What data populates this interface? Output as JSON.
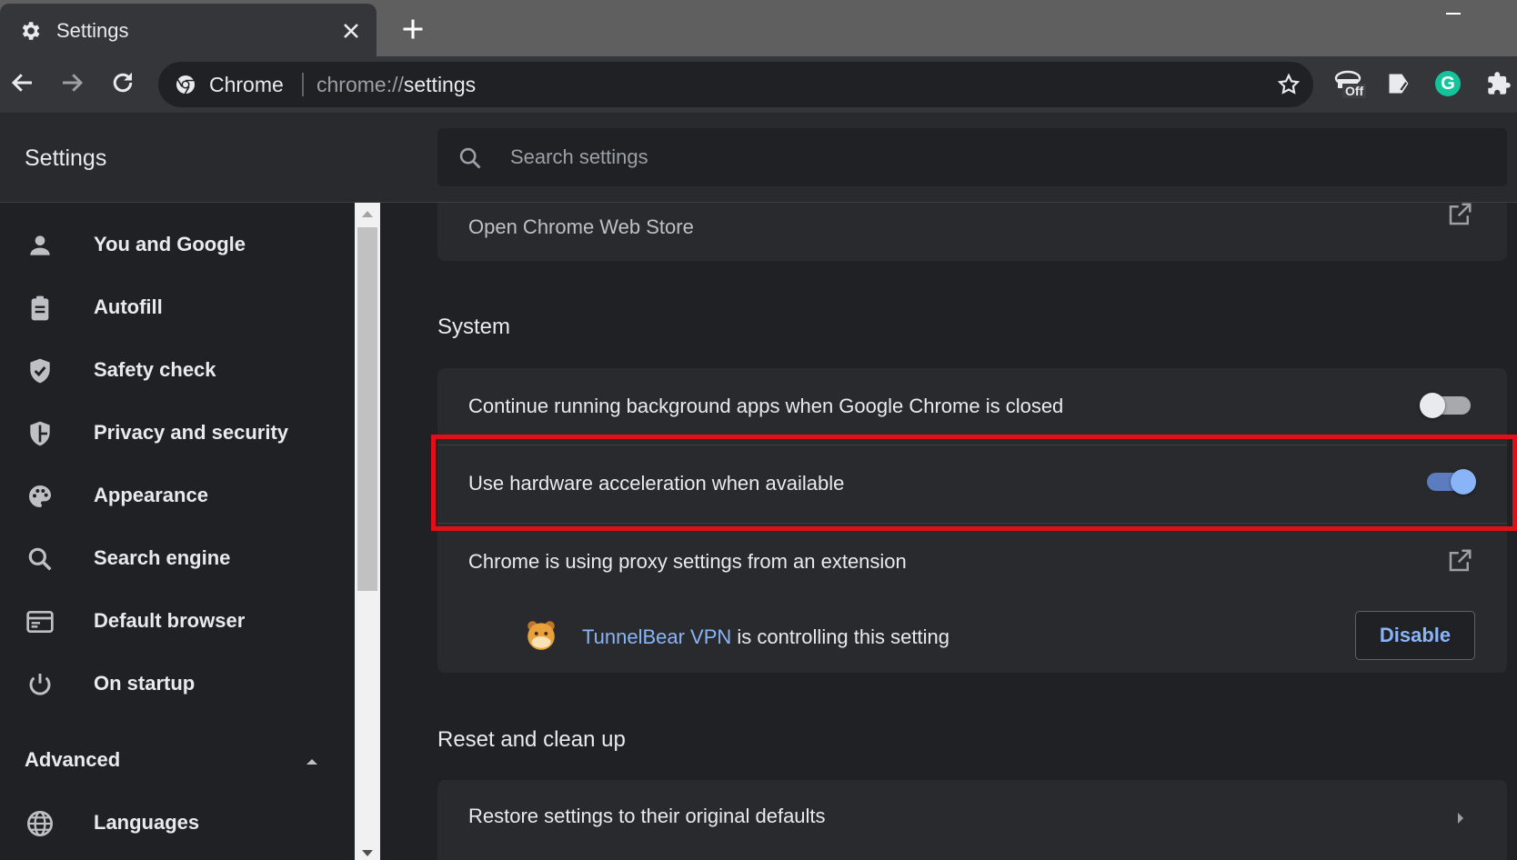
{
  "browser": {
    "tab_title": "Settings",
    "omnibox": {
      "chip_label": "Chrome",
      "url_scheme": "chrome://",
      "url_host": "settings"
    },
    "extensions": [
      {
        "name": "proxy-off-extension-icon",
        "badge": "Off"
      },
      {
        "name": "tag-extension-icon"
      },
      {
        "name": "grammarly-extension-icon",
        "letter": "G",
        "color": "#15c39a"
      },
      {
        "name": "extensions-puzzle-icon"
      }
    ]
  },
  "settings": {
    "header_title": "Settings",
    "search_placeholder": "Search settings",
    "sidebar": {
      "items": [
        {
          "label": "You and Google",
          "icon": "person-icon"
        },
        {
          "label": "Autofill",
          "icon": "clipboard-icon"
        },
        {
          "label": "Safety check",
          "icon": "shield-check-icon"
        },
        {
          "label": "Privacy and security",
          "icon": "shield-icon"
        },
        {
          "label": "Appearance",
          "icon": "palette-icon"
        },
        {
          "label": "Search engine",
          "icon": "search-icon"
        },
        {
          "label": "Default browser",
          "icon": "browser-window-icon"
        },
        {
          "label": "On startup",
          "icon": "power-icon"
        }
      ],
      "advanced_label": "Advanced",
      "advanced_items": [
        {
          "label": "Languages",
          "icon": "globe-icon"
        }
      ]
    },
    "main": {
      "web_store_link": "Open Chrome Web Store",
      "system": {
        "title": "System",
        "background_apps": {
          "label": "Continue running background apps when Google Chrome is closed",
          "enabled": false
        },
        "hardware_acceleration": {
          "label": "Use hardware acceleration when available",
          "enabled": true
        },
        "proxy": {
          "label": "Chrome is using proxy settings from an extension",
          "extension_name": "TunnelBear VPN",
          "controlling_text": " is controlling this setting",
          "disable_label": "Disable"
        }
      },
      "reset": {
        "title": "Reset and clean up",
        "restore_label": "Restore settings to their original defaults"
      }
    }
  },
  "colors": {
    "accent": "#8ab4f8",
    "toggle_on_track": "#5b7cbf",
    "toggle_on_knob": "#8ab4f8",
    "toggle_off_track": "#a7a9ac",
    "toggle_off_knob": "#e8eaed",
    "highlight": "#e0101b"
  }
}
